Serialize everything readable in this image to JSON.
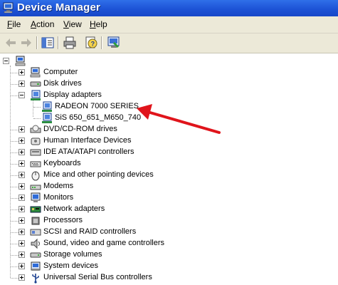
{
  "window": {
    "title": "Device Manager"
  },
  "menu": [
    {
      "acc": "F",
      "rest": "ile"
    },
    {
      "acc": "A",
      "rest": "ction"
    },
    {
      "acc": "V",
      "rest": "iew"
    },
    {
      "acc": "H",
      "rest": "elp"
    }
  ],
  "toolbar": {
    "buttons": [
      "back-icon",
      "forward-icon",
      "show-hide-tree-icon",
      "print-icon",
      "help-icon",
      "properties-icon"
    ]
  },
  "tree": {
    "root_icon": "computer-icon",
    "categories": [
      {
        "label": "Computer",
        "icon": "computer-icon"
      },
      {
        "label": "Disk drives",
        "icon": "disk-drive-icon"
      },
      {
        "label": "Display adapters",
        "icon": "display-adapter-icon",
        "expanded": true,
        "children": [
          "RADEON 7000 SERIES",
          "SiS 650_651_M650_740"
        ]
      },
      {
        "label": "DVD/CD-ROM drives",
        "icon": "cdrom-icon"
      },
      {
        "label": "Human Interface Devices",
        "icon": "hid-icon"
      },
      {
        "label": "IDE ATA/ATAPI controllers",
        "icon": "ide-controller-icon"
      },
      {
        "label": "Keyboards",
        "icon": "keyboard-icon"
      },
      {
        "label": "Mice and other pointing devices",
        "icon": "mouse-icon"
      },
      {
        "label": "Modems",
        "icon": "modem-icon"
      },
      {
        "label": "Monitors",
        "icon": "monitor-icon"
      },
      {
        "label": "Network adapters",
        "icon": "network-adapter-icon"
      },
      {
        "label": "Processors",
        "icon": "processor-icon"
      },
      {
        "label": "SCSI and RAID controllers",
        "icon": "scsi-icon"
      },
      {
        "label": "Sound, video and game controllers",
        "icon": "sound-icon"
      },
      {
        "label": "Storage volumes",
        "icon": "storage-volume-icon"
      },
      {
        "label": "System devices",
        "icon": "system-device-icon"
      },
      {
        "label": "Universal Serial Bus controllers",
        "icon": "usb-icon"
      }
    ]
  },
  "annotation": {
    "arrow_color": "#e0141b"
  },
  "colors": {
    "titlebar": "#1d53d6",
    "chrome": "#ece9d8"
  }
}
